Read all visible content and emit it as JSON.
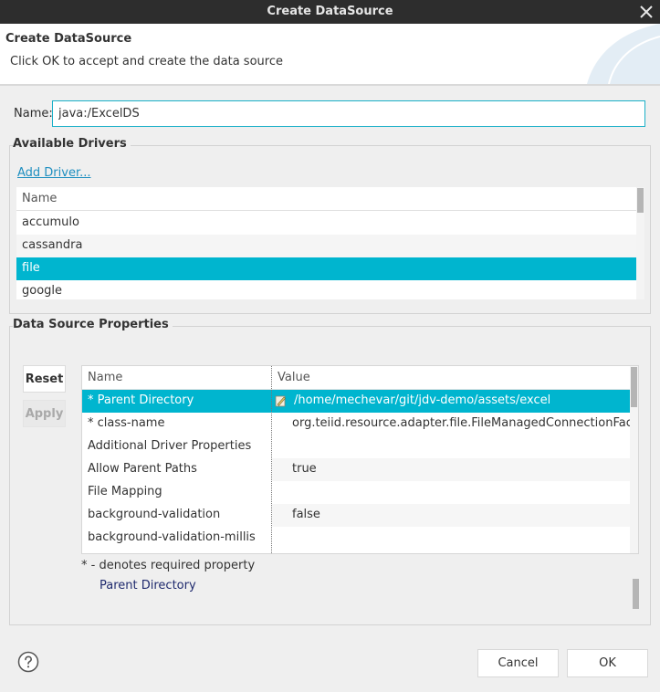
{
  "window": {
    "title": "Create DataSource"
  },
  "header": {
    "title": "Create DataSource",
    "description": "Click OK to accept and create the data source"
  },
  "name_field": {
    "label": "Name:",
    "value": "java:/ExcelDS"
  },
  "drivers": {
    "group_title": "Available Drivers",
    "add_driver_label": "Add Driver...",
    "column_header": "Name",
    "items": [
      {
        "label": "accumulo",
        "selected": false
      },
      {
        "label": "cassandra",
        "selected": false
      },
      {
        "label": "file",
        "selected": true
      },
      {
        "label": "google",
        "selected": false
      }
    ]
  },
  "properties": {
    "group_title": "Data Source Properties",
    "reset_label": "Reset",
    "apply_label": "Apply",
    "columns": {
      "name": "Name",
      "value": "Value"
    },
    "rows": [
      {
        "name": "* Parent Directory",
        "value": "/home/mechevar/git/jdv-demo/assets/excel",
        "selected": true
      },
      {
        "name": "* class-name",
        "value": "org.teiid.resource.adapter.file.FileManagedConnectionFactory",
        "selected": false
      },
      {
        "name": "Additional Driver Properties",
        "value": "",
        "selected": false
      },
      {
        "name": "Allow Parent Paths",
        "value": "true",
        "selected": false
      },
      {
        "name": "File Mapping",
        "value": "",
        "selected": false
      },
      {
        "name": "background-validation",
        "value": "false",
        "selected": false
      },
      {
        "name": "background-validation-millis",
        "value": "",
        "selected": false
      }
    ],
    "required_note": "* - denotes required property",
    "description_name": "Parent Directory"
  },
  "footer": {
    "cancel_label": "Cancel",
    "ok_label": "OK"
  },
  "colors": {
    "accent": "#00b5cf",
    "titlebar": "#2d2d2d",
    "link": "#1f8fc0"
  }
}
